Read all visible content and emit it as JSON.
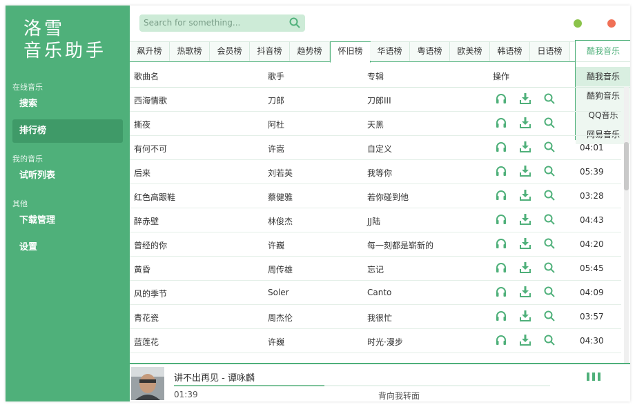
{
  "logo": {
    "line1": "洛雪",
    "line2": "音乐助手"
  },
  "sidebar": {
    "section_online": "在线音乐",
    "search": "搜索",
    "charts": "排行榜",
    "section_mine": "我的音乐",
    "trial_list": "试听列表",
    "section_other": "其他",
    "downloads": "下载管理",
    "settings": "设置"
  },
  "search": {
    "placeholder": "Search for something..."
  },
  "window_dots": {
    "min_color": "#8bc34a",
    "close_color": "#f07056"
  },
  "tabs": [
    "飙升榜",
    "热歌榜",
    "会员榜",
    "抖音榜",
    "趋势榜",
    "怀旧榜",
    "华语榜",
    "粤语榜",
    "欧美榜",
    "韩语榜",
    "日语榜"
  ],
  "active_tab": "怀旧榜",
  "source_dropdown": {
    "selected": "酷我音乐",
    "options": [
      "酷我音乐",
      "酷狗音乐",
      "QQ音乐",
      "网易音乐"
    ]
  },
  "table": {
    "headers": {
      "name": "歌曲名",
      "artist": "歌手",
      "album": "专辑",
      "ops": "操作"
    },
    "rows": [
      {
        "name": "西海情歌",
        "artist": "刀郎",
        "album": "刀郎III",
        "time": ""
      },
      {
        "name": "撕夜",
        "artist": "阿杜",
        "album": "天黑",
        "time": ""
      },
      {
        "name": "有何不可",
        "artist": "许嵩",
        "album": "自定义",
        "time": "04:01"
      },
      {
        "name": "后来",
        "artist": "刘若英",
        "album": "我等你",
        "time": "05:39"
      },
      {
        "name": "红色高跟鞋",
        "artist": "蔡健雅",
        "album": "若你碰到他",
        "time": "03:28"
      },
      {
        "name": "醉赤壁",
        "artist": "林俊杰",
        "album": "JJ陆",
        "time": "04:43"
      },
      {
        "name": "曾经的你",
        "artist": "许巍",
        "album": "每一刻都是崭新的",
        "time": "04:20"
      },
      {
        "name": "黄昏",
        "artist": "周传雄",
        "album": "忘记",
        "time": "05:45"
      },
      {
        "name": "风的季节",
        "artist": "Soler",
        "album": "Canto",
        "time": "04:09"
      },
      {
        "name": "青花瓷",
        "artist": "周杰伦",
        "album": "我很忙",
        "time": "03:57"
      },
      {
        "name": "蓝莲花",
        "artist": "许巍",
        "album": "时光·漫步",
        "time": "04:30"
      }
    ]
  },
  "player": {
    "title": "讲不出再见 - 谭咏麟",
    "current_time": "01:39",
    "lyric": "背向我转面",
    "progress": 0.4
  },
  "accent_color": "#4fb07a"
}
